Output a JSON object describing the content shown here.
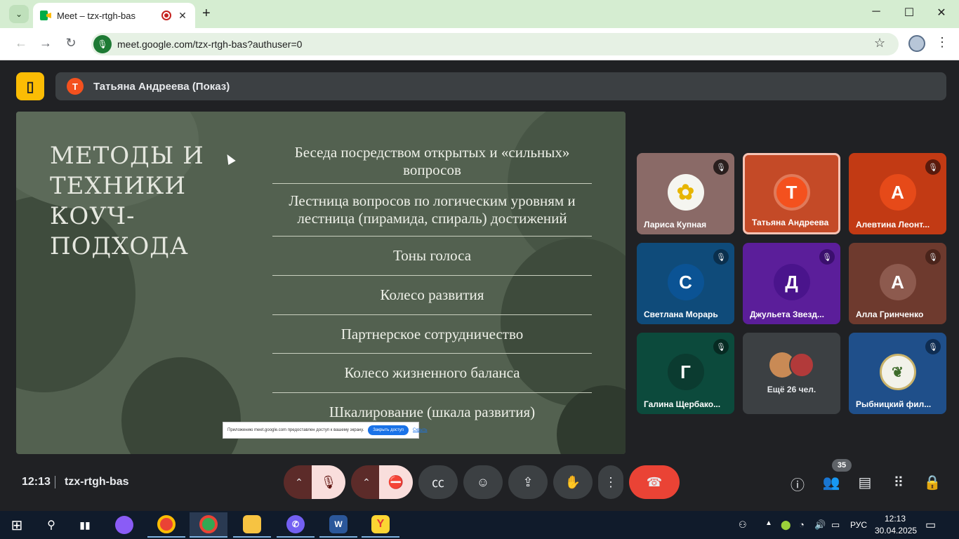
{
  "browser": {
    "tab_title": "Meet – tzx-rtgh-bas",
    "url": "meet.google.com/tzx-rtgh-bas?authuser=0"
  },
  "meet": {
    "presenter_initial": "Т",
    "presenter_label": "Татьяна Андреева (Показ)",
    "slide": {
      "title": "МЕТОДЫ И ТЕХНИКИ КОУЧ-ПОДХОДА",
      "items": [
        "Беседа посредством открытых и «сильных» вопросов",
        "Лестница вопросов по логическим уровням и лестница (пирамида, спираль) достижений",
        "Тоны голоса",
        "Колесо развития",
        "Партнерское сотрудничество",
        "Колесо жизненного баланса",
        "Шкалирование (шкала развития)"
      ],
      "notice_text": "Приложению meet.google.com предоставлен доступ к вашему экрану.",
      "notice_button": "Закрыть доступ",
      "notice_link": "Скрыть"
    },
    "participants": [
      {
        "name": "Лариса Купная",
        "initial": "",
        "muted": true
      },
      {
        "name": "Татьяна Андреева",
        "initial": "Т",
        "muted": false
      },
      {
        "name": "Алевтина Леонт...",
        "initial": "А",
        "muted": true
      },
      {
        "name": "Светлана Морарь",
        "initial": "С",
        "muted": true
      },
      {
        "name": "Джульета Звезд...",
        "initial": "Д",
        "muted": true
      },
      {
        "name": "Алла Гринченко",
        "initial": "А",
        "muted": true
      },
      {
        "name": "Галина Щербако...",
        "initial": "Г",
        "muted": true
      },
      {
        "name": "Рыбницкий фил...",
        "initial": "",
        "muted": true
      }
    ],
    "more_label": "Ещё 26 чел.",
    "time": "12:13",
    "meeting_code": "tzx-rtgh-bas",
    "participant_count": "35"
  },
  "taskbar": {
    "lang": "РУС",
    "time": "12:13",
    "date": "30.04.2025"
  },
  "colors": {
    "accent_red": "#ea4335",
    "presenter_yellow": "#fbbc04",
    "slide_green": "#536150"
  }
}
